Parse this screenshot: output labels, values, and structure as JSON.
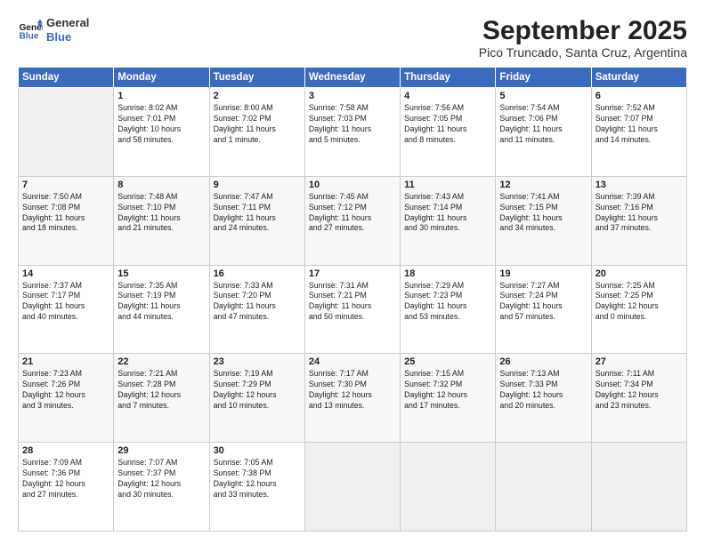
{
  "header": {
    "logo_line1": "General",
    "logo_line2": "Blue",
    "title": "September 2025",
    "subtitle": "Pico Truncado, Santa Cruz, Argentina"
  },
  "columns": [
    "Sunday",
    "Monday",
    "Tuesday",
    "Wednesday",
    "Thursday",
    "Friday",
    "Saturday"
  ],
  "weeks": [
    [
      {
        "num": "",
        "info": ""
      },
      {
        "num": "1",
        "info": "Sunrise: 8:02 AM\nSunset: 7:01 PM\nDaylight: 10 hours\nand 58 minutes."
      },
      {
        "num": "2",
        "info": "Sunrise: 8:00 AM\nSunset: 7:02 PM\nDaylight: 11 hours\nand 1 minute."
      },
      {
        "num": "3",
        "info": "Sunrise: 7:58 AM\nSunset: 7:03 PM\nDaylight: 11 hours\nand 5 minutes."
      },
      {
        "num": "4",
        "info": "Sunrise: 7:56 AM\nSunset: 7:05 PM\nDaylight: 11 hours\nand 8 minutes."
      },
      {
        "num": "5",
        "info": "Sunrise: 7:54 AM\nSunset: 7:06 PM\nDaylight: 11 hours\nand 11 minutes."
      },
      {
        "num": "6",
        "info": "Sunrise: 7:52 AM\nSunset: 7:07 PM\nDaylight: 11 hours\nand 14 minutes."
      }
    ],
    [
      {
        "num": "7",
        "info": "Sunrise: 7:50 AM\nSunset: 7:08 PM\nDaylight: 11 hours\nand 18 minutes."
      },
      {
        "num": "8",
        "info": "Sunrise: 7:48 AM\nSunset: 7:10 PM\nDaylight: 11 hours\nand 21 minutes."
      },
      {
        "num": "9",
        "info": "Sunrise: 7:47 AM\nSunset: 7:11 PM\nDaylight: 11 hours\nand 24 minutes."
      },
      {
        "num": "10",
        "info": "Sunrise: 7:45 AM\nSunset: 7:12 PM\nDaylight: 11 hours\nand 27 minutes."
      },
      {
        "num": "11",
        "info": "Sunrise: 7:43 AM\nSunset: 7:14 PM\nDaylight: 11 hours\nand 30 minutes."
      },
      {
        "num": "12",
        "info": "Sunrise: 7:41 AM\nSunset: 7:15 PM\nDaylight: 11 hours\nand 34 minutes."
      },
      {
        "num": "13",
        "info": "Sunrise: 7:39 AM\nSunset: 7:16 PM\nDaylight: 11 hours\nand 37 minutes."
      }
    ],
    [
      {
        "num": "14",
        "info": "Sunrise: 7:37 AM\nSunset: 7:17 PM\nDaylight: 11 hours\nand 40 minutes."
      },
      {
        "num": "15",
        "info": "Sunrise: 7:35 AM\nSunset: 7:19 PM\nDaylight: 11 hours\nand 44 minutes."
      },
      {
        "num": "16",
        "info": "Sunrise: 7:33 AM\nSunset: 7:20 PM\nDaylight: 11 hours\nand 47 minutes."
      },
      {
        "num": "17",
        "info": "Sunrise: 7:31 AM\nSunset: 7:21 PM\nDaylight: 11 hours\nand 50 minutes."
      },
      {
        "num": "18",
        "info": "Sunrise: 7:29 AM\nSunset: 7:23 PM\nDaylight: 11 hours\nand 53 minutes."
      },
      {
        "num": "19",
        "info": "Sunrise: 7:27 AM\nSunset: 7:24 PM\nDaylight: 11 hours\nand 57 minutes."
      },
      {
        "num": "20",
        "info": "Sunrise: 7:25 AM\nSunset: 7:25 PM\nDaylight: 12 hours\nand 0 minutes."
      }
    ],
    [
      {
        "num": "21",
        "info": "Sunrise: 7:23 AM\nSunset: 7:26 PM\nDaylight: 12 hours\nand 3 minutes."
      },
      {
        "num": "22",
        "info": "Sunrise: 7:21 AM\nSunset: 7:28 PM\nDaylight: 12 hours\nand 7 minutes."
      },
      {
        "num": "23",
        "info": "Sunrise: 7:19 AM\nSunset: 7:29 PM\nDaylight: 12 hours\nand 10 minutes."
      },
      {
        "num": "24",
        "info": "Sunrise: 7:17 AM\nSunset: 7:30 PM\nDaylight: 12 hours\nand 13 minutes."
      },
      {
        "num": "25",
        "info": "Sunrise: 7:15 AM\nSunset: 7:32 PM\nDaylight: 12 hours\nand 17 minutes."
      },
      {
        "num": "26",
        "info": "Sunrise: 7:13 AM\nSunset: 7:33 PM\nDaylight: 12 hours\nand 20 minutes."
      },
      {
        "num": "27",
        "info": "Sunrise: 7:11 AM\nSunset: 7:34 PM\nDaylight: 12 hours\nand 23 minutes."
      }
    ],
    [
      {
        "num": "28",
        "info": "Sunrise: 7:09 AM\nSunset: 7:36 PM\nDaylight: 12 hours\nand 27 minutes."
      },
      {
        "num": "29",
        "info": "Sunrise: 7:07 AM\nSunset: 7:37 PM\nDaylight: 12 hours\nand 30 minutes."
      },
      {
        "num": "30",
        "info": "Sunrise: 7:05 AM\nSunset: 7:38 PM\nDaylight: 12 hours\nand 33 minutes."
      },
      {
        "num": "",
        "info": ""
      },
      {
        "num": "",
        "info": ""
      },
      {
        "num": "",
        "info": ""
      },
      {
        "num": "",
        "info": ""
      }
    ]
  ]
}
